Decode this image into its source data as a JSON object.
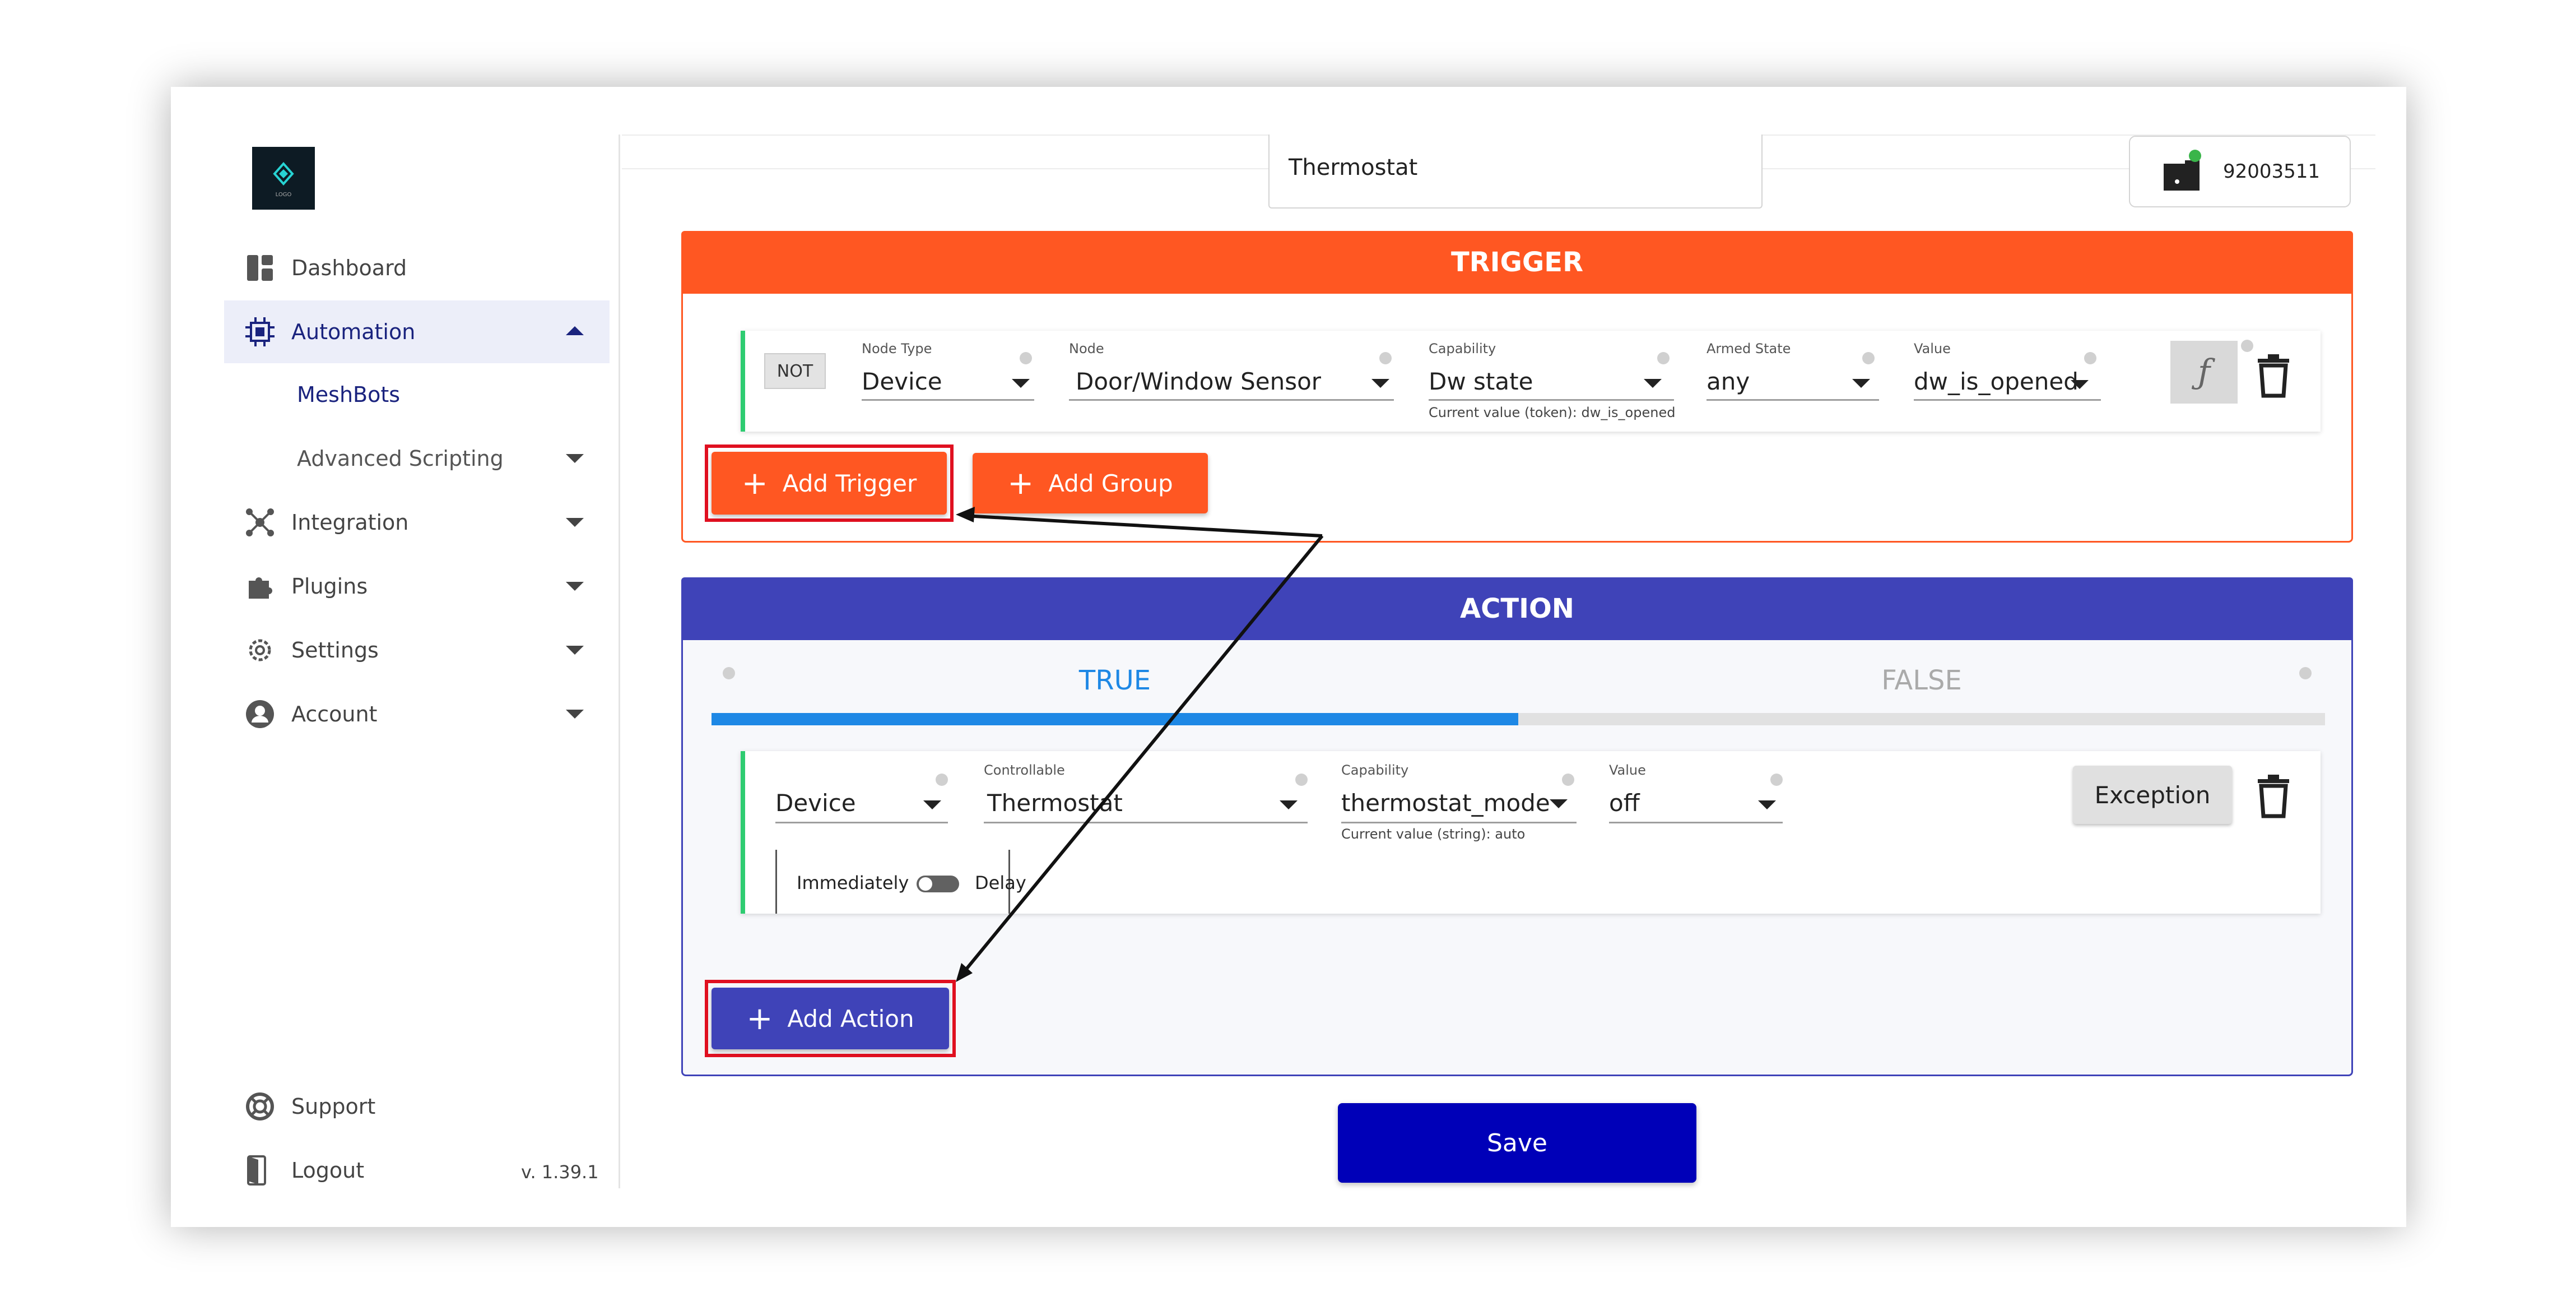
{
  "sidebar": {
    "logo_text": "LOGO",
    "items": [
      {
        "label": "Dashboard",
        "icon": "dashboard-icon"
      },
      {
        "label": "Automation",
        "icon": "automation-chip-icon"
      },
      {
        "label": "MeshBots"
      },
      {
        "label": "Advanced Scripting"
      },
      {
        "label": "Integration",
        "icon": "integration-icon"
      },
      {
        "label": "Plugins",
        "icon": "puzzle-icon"
      },
      {
        "label": "Settings",
        "icon": "gear-icon"
      },
      {
        "label": "Account",
        "icon": "account-icon"
      }
    ],
    "support_label": "Support",
    "logout_label": "Logout",
    "version": "v. 1.39.1"
  },
  "header": {
    "name_value": "Thermostat",
    "hub_serial": "92003511"
  },
  "trigger": {
    "title": "TRIGGER",
    "not_label": "NOT",
    "node_type": {
      "label": "Node Type",
      "value": "Device"
    },
    "node": {
      "label": "Node",
      "value": "Door/Window Sensor"
    },
    "capability": {
      "label": "Capability",
      "value": "Dw state",
      "hint": "Current value (token): dw_is_opened"
    },
    "armed_state": {
      "label": "Armed State",
      "value": "any"
    },
    "value": {
      "label": "Value",
      "value": "dw_is_opened"
    },
    "function_symbol": "ƒ",
    "add_trigger_label": "Add Trigger",
    "add_group_label": "Add Group"
  },
  "action": {
    "title": "ACTION",
    "tab_true": "TRUE",
    "tab_false": "FALSE",
    "type": {
      "value": "Device"
    },
    "controllable": {
      "label": "Controllable",
      "value": "Thermostat"
    },
    "capability": {
      "label": "Capability",
      "value": "thermostat_mode",
      "hint": "Current value (string): auto"
    },
    "value": {
      "label": "Value",
      "value": "off"
    },
    "exception_label": "Exception",
    "immediately_label": "Immediately",
    "delay_label": "Delay",
    "add_action_label": "Add Action"
  },
  "save_label": "Save",
  "colors": {
    "trigger": "#ff5722",
    "action": "#3f43b8",
    "save": "#0000b8",
    "highlight": "#e01020",
    "active_tab": "#1e88e5"
  }
}
